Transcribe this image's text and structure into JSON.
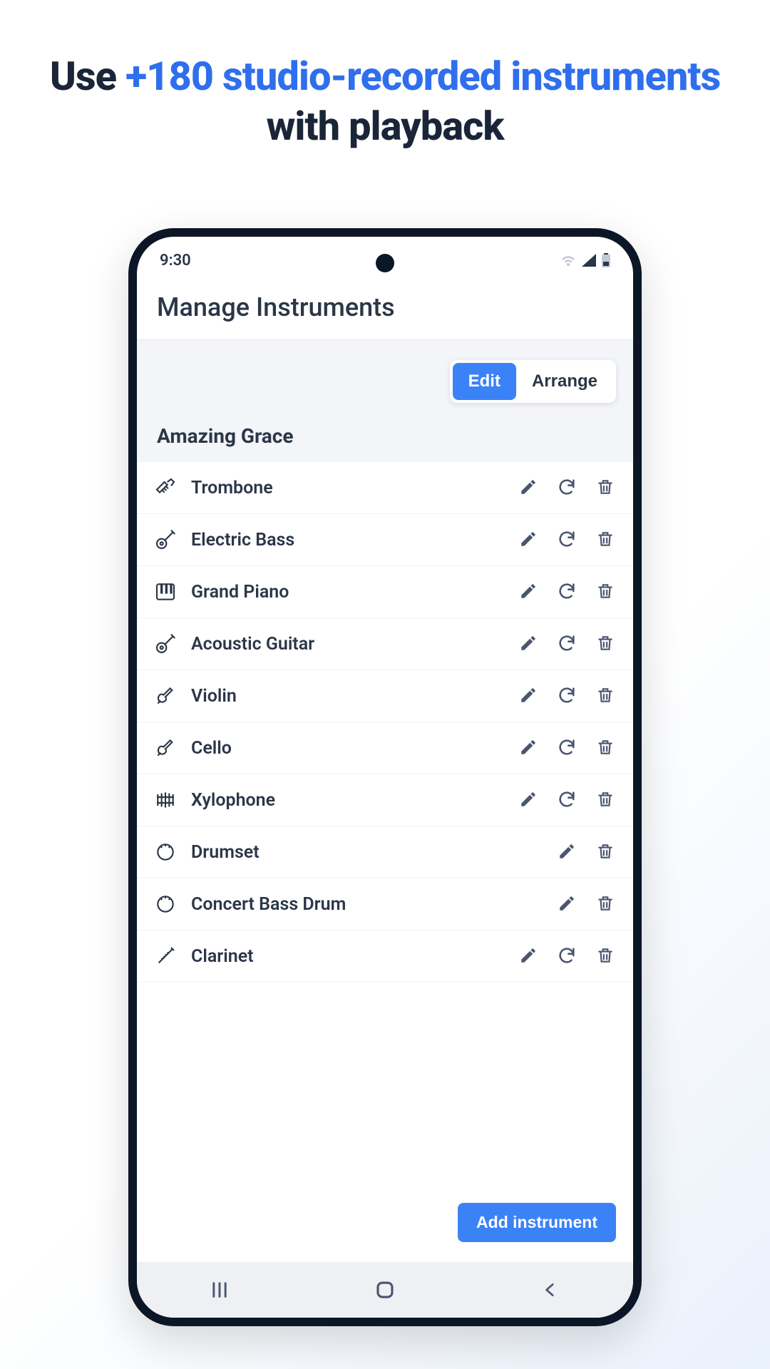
{
  "promo": {
    "pre": "Use ",
    "accent": "+180 studio-recorded instruments",
    "post": " with playback"
  },
  "status": {
    "time": "9:30"
  },
  "page": {
    "title": "Manage Instruments",
    "tabs": {
      "edit": "Edit",
      "arrange": "Arrange"
    },
    "song_title": "Amazing Grace"
  },
  "instruments": [
    {
      "name": "Trombone",
      "icon": "trumpet",
      "edit": true,
      "sync": true,
      "delete": true
    },
    {
      "name": "Electric Bass",
      "icon": "guitar",
      "edit": true,
      "sync": true,
      "delete": true
    },
    {
      "name": "Grand Piano",
      "icon": "piano",
      "edit": true,
      "sync": true,
      "delete": true
    },
    {
      "name": "Acoustic Guitar",
      "icon": "guitar",
      "edit": true,
      "sync": true,
      "delete": true
    },
    {
      "name": "Violin",
      "icon": "violin",
      "edit": true,
      "sync": true,
      "delete": true
    },
    {
      "name": "Cello",
      "icon": "violin",
      "edit": true,
      "sync": true,
      "delete": true
    },
    {
      "name": "Xylophone",
      "icon": "xylophone",
      "edit": true,
      "sync": true,
      "delete": true
    },
    {
      "name": "Drumset",
      "icon": "drum",
      "edit": true,
      "sync": false,
      "delete": true
    },
    {
      "name": "Concert Bass Drum",
      "icon": "drum",
      "edit": true,
      "sync": false,
      "delete": true
    },
    {
      "name": "Clarinet",
      "icon": "clarinet",
      "edit": true,
      "sync": true,
      "delete": true
    }
  ],
  "actions": {
    "add": "Add instrument"
  },
  "colors": {
    "accent": "#3b82f6",
    "text": "#2b3648",
    "muted": "#4a5570"
  }
}
